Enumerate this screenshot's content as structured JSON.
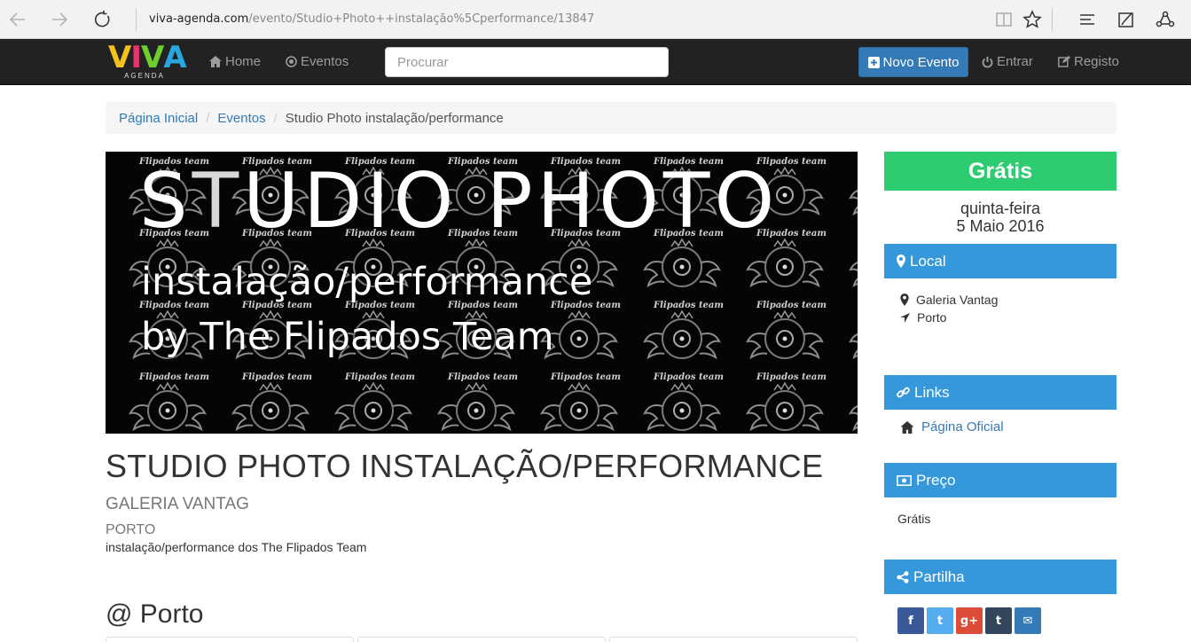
{
  "browser": {
    "url_domain": "viva-agenda.com",
    "url_path": "/evento/Studio+Photo++instalação%5Cperformance/13847"
  },
  "navbar": {
    "logo_letters": [
      "V",
      "I",
      "V",
      "A"
    ],
    "logo_sub": "AGENDA",
    "home_label": "Home",
    "events_label": "Eventos",
    "search_placeholder": "Procurar",
    "new_event_label": "Novo Evento",
    "login_label": "Entrar",
    "register_label": "Registo"
  },
  "breadcrumb": {
    "home": "Página Inicial",
    "events": "Eventos",
    "current": "Studio Photo instalação/performance"
  },
  "hero": {
    "title": "STUDIO PHOTO",
    "line1": "instalação/performance",
    "line2": "by The Flipados Team",
    "pattern_label": "Flipados team"
  },
  "event": {
    "title": "STUDIO PHOTO INSTALAÇÃO/PERFORMANCE",
    "venue": "Galeria Vantag",
    "city": "Porto",
    "description": "instalação/performance dos The Flipados Team",
    "at_city": "@ Porto"
  },
  "sidebar": {
    "price_banner": "Grátis",
    "weekday": "quinta-feira",
    "date": "5 Maio 2016",
    "local_heading": "Local",
    "local_venue": "Galeria Vantag",
    "local_city": "Porto",
    "links_heading": "Links",
    "official_page": "Página Oficial",
    "price_heading": "Preço",
    "price_value": "Grátis",
    "share_heading": "Partilha",
    "share_buttons": [
      {
        "label": "f",
        "color": "#3b5998"
      },
      {
        "label": "t",
        "color": "#55acee"
      },
      {
        "label": "g+",
        "color": "#dd4b39"
      },
      {
        "label": "t",
        "color": "#35465c"
      },
      {
        "label": "✉",
        "color": "#337ab7"
      }
    ]
  },
  "colors": {
    "navbar_bg": "#222222",
    "primary": "#337ab7",
    "green": "#2ecc71",
    "panel_blue": "#3498db"
  }
}
